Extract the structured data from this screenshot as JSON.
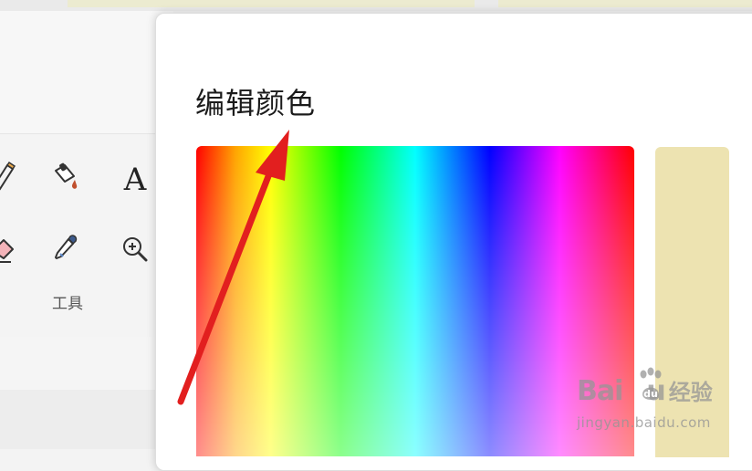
{
  "dialog": {
    "title": "编辑颜色",
    "spectrum_hues": [
      "#ff0000",
      "#ffff00",
      "#00ff00",
      "#00ffff",
      "#0000ff",
      "#ff00ff"
    ],
    "current_color": "#ede3b1"
  },
  "ribbon": {
    "tools_group_label": "工具",
    "tools": [
      {
        "name": "pencil-icon"
      },
      {
        "name": "fill-bucket-icon"
      },
      {
        "name": "text-icon",
        "glyph": "A"
      },
      {
        "name": "eraser-icon"
      },
      {
        "name": "color-picker-icon"
      },
      {
        "name": "magnifier-icon"
      }
    ]
  },
  "annotation": {
    "color": "#e21f1f"
  },
  "watermark": {
    "logo_text": "Bai",
    "logo_text_tail": "u",
    "logo_cn": "经验",
    "url": "jingyan.baidu.com"
  }
}
